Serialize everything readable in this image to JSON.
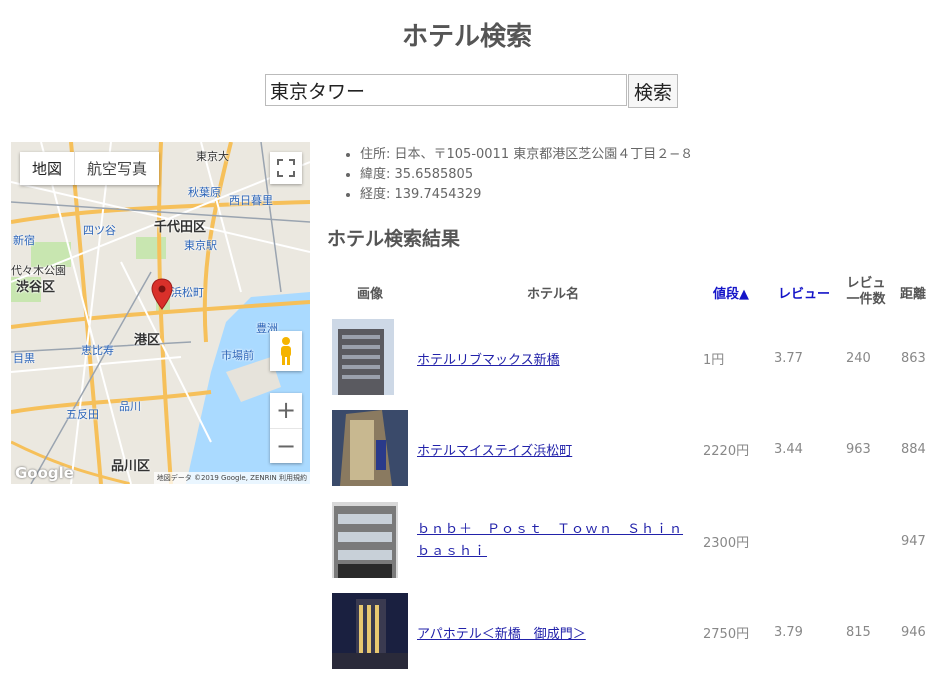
{
  "page": {
    "title": "ホテル検索"
  },
  "search": {
    "value": "東京タワー",
    "button_label": "検索"
  },
  "map": {
    "type_buttons": [
      "地図",
      "航空写真"
    ],
    "labels": [
      "千代田区",
      "渋谷区",
      "港区",
      "品川区",
      "東京駅",
      "秋葉原",
      "恵比寿",
      "五反田",
      "品川",
      "浜松町",
      "豊洲",
      "市場前",
      "目黒",
      "四ツ谷",
      "新宿",
      "代々木公園",
      "西日暮里",
      "東京大"
    ],
    "attribution": "地図データ ©2019 Google, ZENRIN  利用規約",
    "logo_text": "Google",
    "zoom_in": "+",
    "zoom_out": "−"
  },
  "info": {
    "address": "住所: 日本、〒105-0011 東京都港区芝公園４丁目２−８",
    "latitude": "緯度: 35.6585805",
    "longitude": "経度: 139.7454329"
  },
  "results": {
    "title": "ホテル検索結果",
    "headers": {
      "image": "画像",
      "name": "ホテル名",
      "price": "値段▲",
      "review": "レビュー",
      "review_count": "レビュ一件数",
      "distance": "距離"
    },
    "rows": [
      {
        "name": "ホテルリブマックス新橋",
        "price": "1円",
        "review": "3.77",
        "count": "240",
        "distance": "863"
      },
      {
        "name": "ホテルマイステイズ浜松町",
        "price": "2220円",
        "review": "3.44",
        "count": "963",
        "distance": "884"
      },
      {
        "name": "ｂｎｂ＋　Ｐｏｓｔ　Ｔｏｗｎ　Ｓｈｉｎｂａｓｈｉ",
        "price": "2300円",
        "review": "",
        "count": "",
        "distance": "947"
      },
      {
        "name": "アパホテル＜新橋　御成門＞",
        "price": "2750円",
        "review": "3.79",
        "count": "815",
        "distance": "946"
      }
    ]
  },
  "colors": {
    "sort_header": "#1414c8",
    "link": "#2222aa",
    "pin": "#d9302a"
  }
}
